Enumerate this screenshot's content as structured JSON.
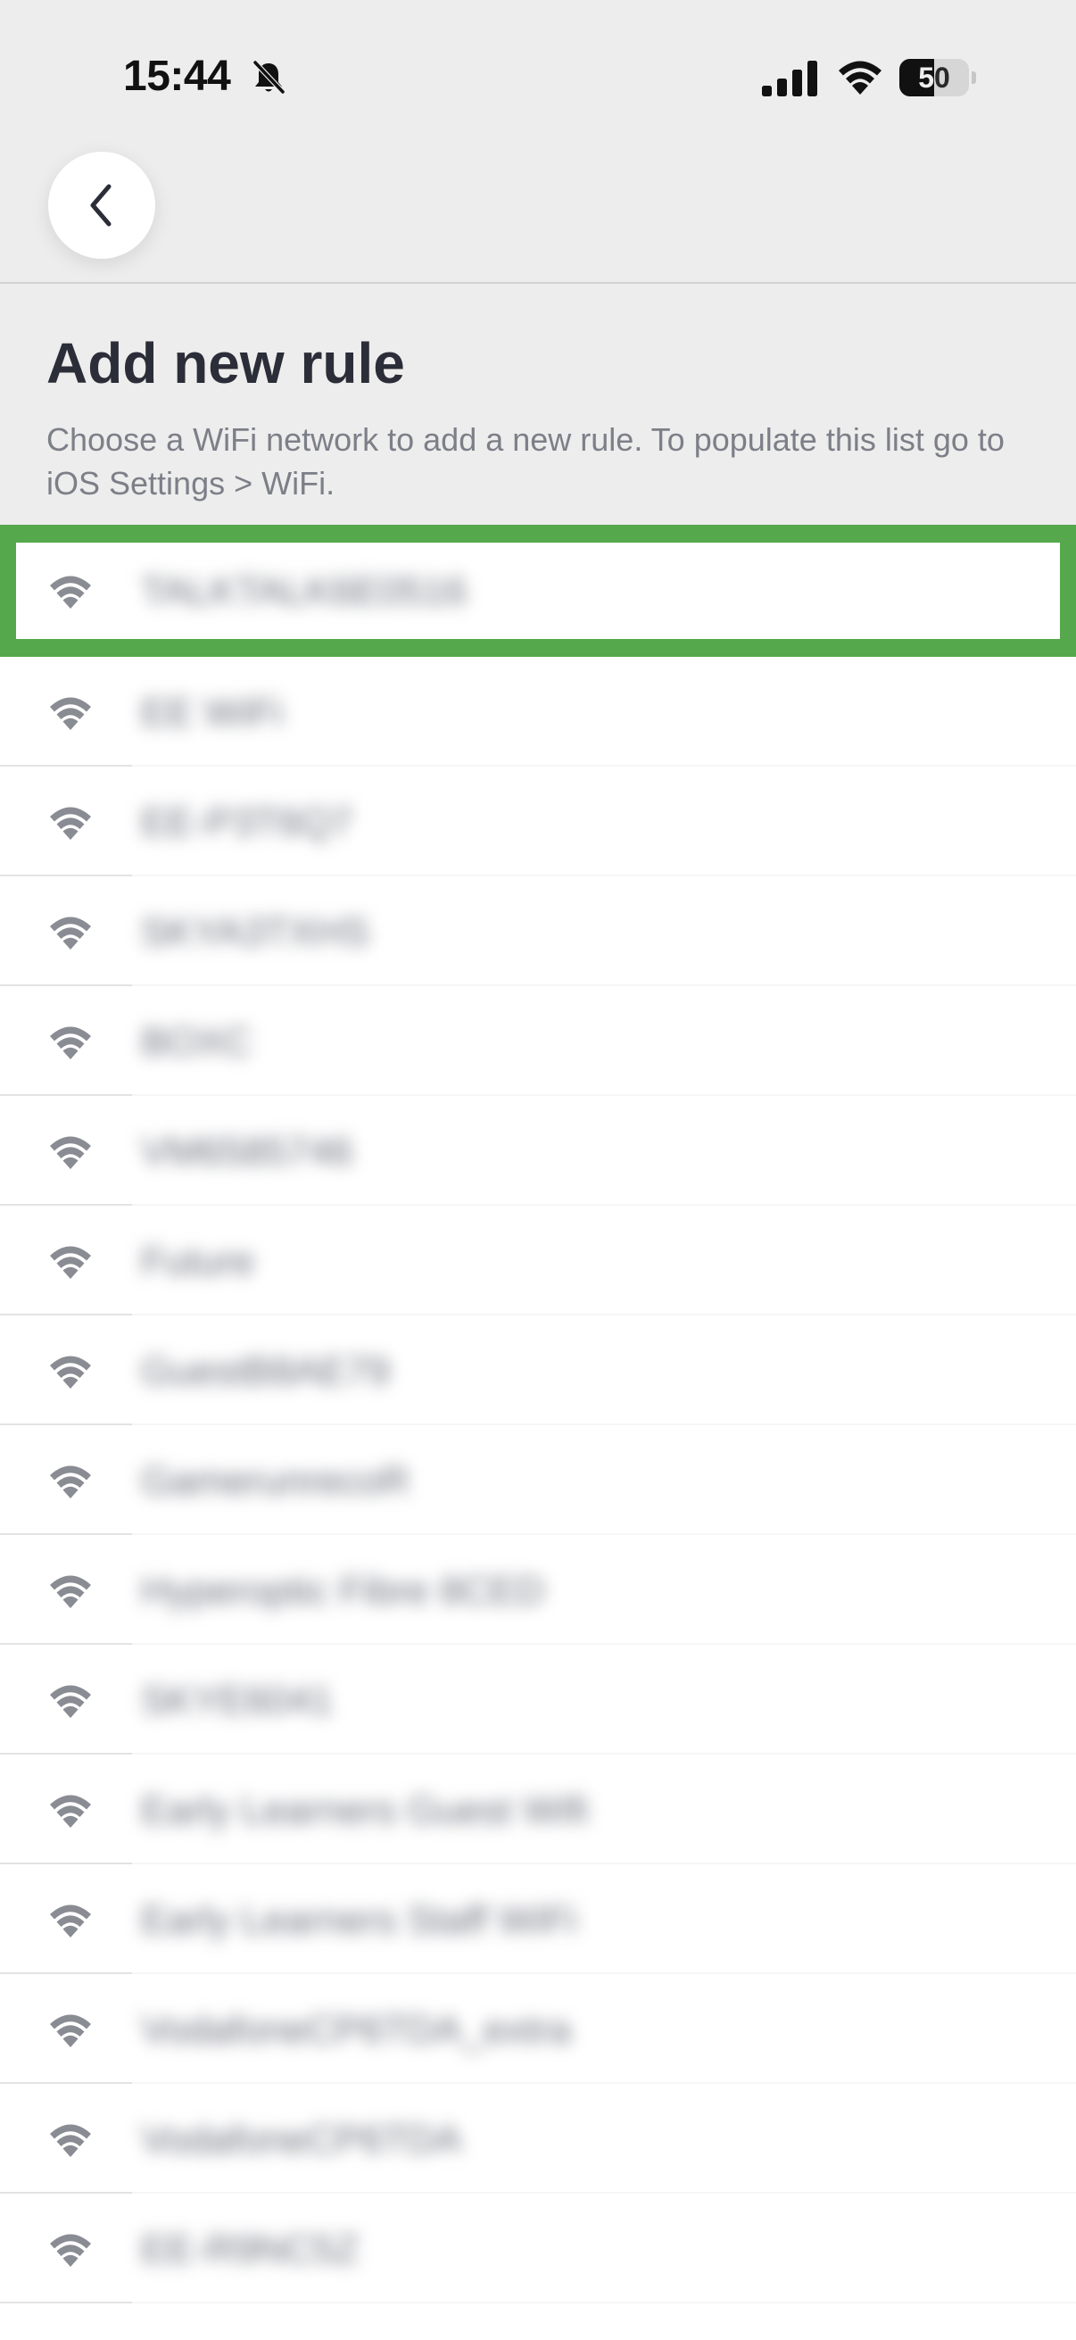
{
  "status_bar": {
    "time": "15:44",
    "battery_level": "50",
    "battery_fraction": 0.5,
    "icons": [
      "bell-slash-icon",
      "cellular-signal-icon",
      "wifi-icon",
      "battery-icon"
    ]
  },
  "navigation": {
    "back_icon": "chevron-left-icon"
  },
  "page": {
    "title": "Add new rule",
    "subtitle": "Choose a WiFi network to add a new rule. To populate this list go to iOS Settings > WiFi."
  },
  "networks": [
    {
      "name": "TALKTALK6E0516",
      "selected": true
    },
    {
      "name": "EE WiFi",
      "selected": false
    },
    {
      "name": "EE-P3T6Q7",
      "selected": false
    },
    {
      "name": "SKYA3TXHS",
      "selected": false
    },
    {
      "name": "BOXC",
      "selected": false
    },
    {
      "name": "VM6585746",
      "selected": false
    },
    {
      "name": "Future",
      "selected": false
    },
    {
      "name": "GuestB8AE79",
      "selected": false
    },
    {
      "name": "GamerunrecoR",
      "selected": false
    },
    {
      "name": "Hyperoptic Fibre 8CED",
      "selected": false
    },
    {
      "name": "SKYE6041",
      "selected": false
    },
    {
      "name": "Early Learners Guest Wifi",
      "selected": false
    },
    {
      "name": "Early Learners Staff WiFi",
      "selected": false
    },
    {
      "name": "VodafoneCP6TDA_extra",
      "selected": false
    },
    {
      "name": "VodafoneCP6TDA",
      "selected": false
    },
    {
      "name": "EE-R9NC5Z",
      "selected": false
    }
  ],
  "colors": {
    "header_background": "#ededed",
    "title_text": "#2b2d38",
    "subtitle_text": "#7d7f88",
    "selection_outline": "#55a84b",
    "wifi_icon": "#8a8c94"
  }
}
